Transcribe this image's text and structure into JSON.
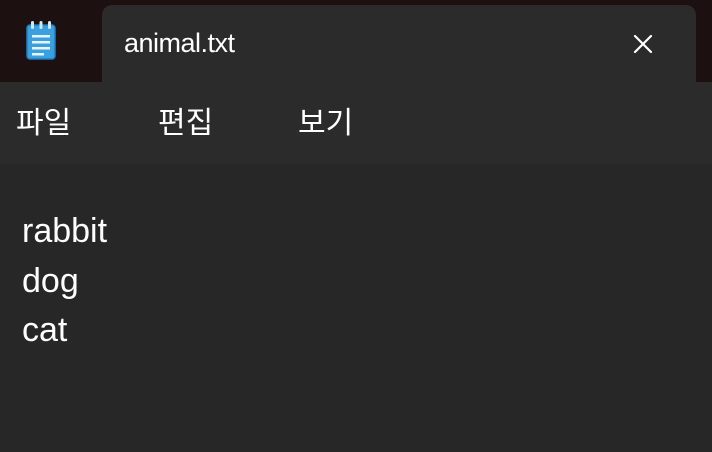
{
  "window": {
    "tab_title": "animal.txt",
    "app_icon": "notepad-icon",
    "close_icon": "close-icon"
  },
  "menu": {
    "file": "파일",
    "edit": "편집",
    "view": "보기"
  },
  "editor": {
    "lines": [
      "rabbit",
      "dog",
      "cat"
    ]
  },
  "colors": {
    "titlebar_bg": "#1c1010",
    "tab_bg": "#2b2b2b",
    "editor_bg": "#272727",
    "text": "#ffffff",
    "icon_accent": "#3aa0e0"
  }
}
